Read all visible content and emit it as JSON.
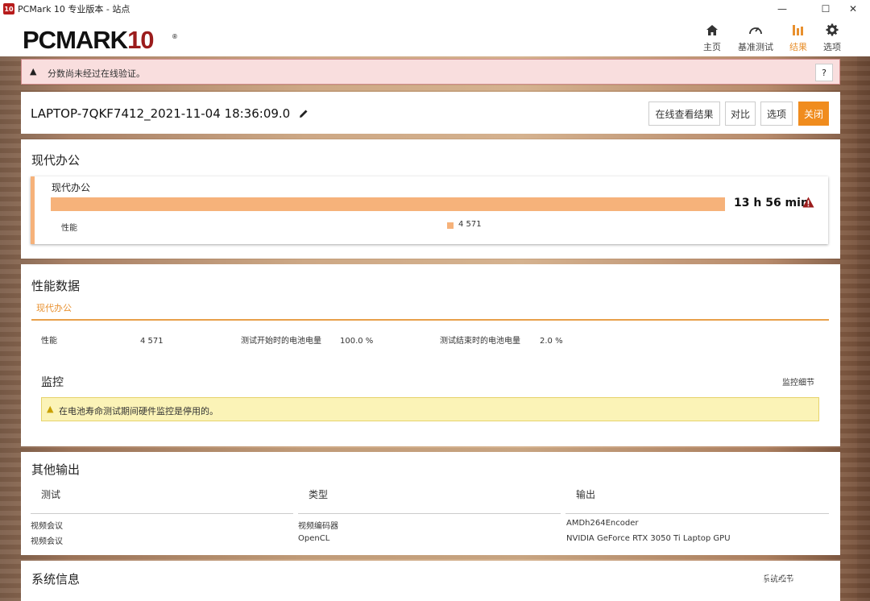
{
  "window": {
    "title": "PCMark 10 专业版本 - 站点",
    "app_icon_text": "10",
    "minimize": "—",
    "maximize": "☐",
    "close": "✕"
  },
  "logo": {
    "main": "PCMARK",
    "ten": "10",
    "reg": "®"
  },
  "nav": [
    {
      "label": "主页",
      "icon": "home-icon"
    },
    {
      "label": "基准测试",
      "icon": "speedometer-icon"
    },
    {
      "label": "结果",
      "icon": "bar-chart-icon",
      "active": true
    },
    {
      "label": "选项",
      "icon": "gear-icon"
    }
  ],
  "warning": {
    "text": "分数尚未经过在线验证。",
    "help": "?"
  },
  "result": {
    "title": "LAPTOP-7QKF7412_2021-11-04 18:36:09.0",
    "buttons": {
      "view_online": "在线查看结果",
      "compare": "对比",
      "options": "选项",
      "close": "关闭"
    }
  },
  "modern_office": {
    "section_title": "现代办公",
    "card_label": "现代办公",
    "time": "13 h 56 min",
    "perf_label": "性能",
    "perf_value": "4 571"
  },
  "perf_data": {
    "section_title": "性能数据",
    "tab": "现代办公",
    "items": [
      {
        "label": "性能",
        "value": "4 571"
      },
      {
        "label": "测试开始时的电池电量",
        "value": "100.0 %"
      },
      {
        "label": "测试结束时的电池电量",
        "value": "2.0 %"
      }
    ],
    "monitor_title": "监控",
    "monitor_link": "监控细节",
    "monitor_warning": "在电池寿命测试期间硬件监控是停用的。"
  },
  "other_output": {
    "section_title": "其他输出",
    "headers": [
      "测试",
      "类型",
      "输出"
    ],
    "rows": [
      [
        "视频会议",
        "视频编码器",
        "AMDh264Encoder"
      ],
      [
        "视频会议",
        "OpenCL",
        "NVIDIA GeForce RTX 3050 Ti Laptop GPU"
      ]
    ]
  },
  "system_info": {
    "section_title": "系统信息",
    "link": "系统细节"
  },
  "watermark": "值 什么值得买",
  "colors": {
    "accent": "#f08c1e",
    "bar": "#f6b27a",
    "brand_red": "#9b1c1c"
  }
}
